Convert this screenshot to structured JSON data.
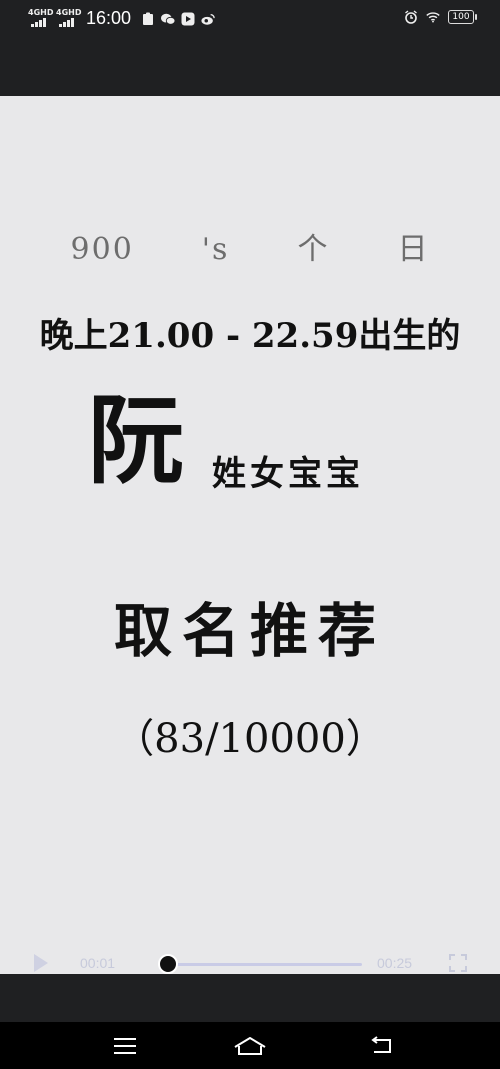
{
  "status_bar": {
    "signal1": "4GHD",
    "signal2": "4GHD",
    "time": "16:00",
    "battery": "100"
  },
  "video": {
    "line1": [
      "900",
      "'s",
      "个",
      "日"
    ],
    "line2": "晚上21.00 - 22.59出生的",
    "surname": "阮",
    "surname_suffix": "姓女宝宝",
    "heading": "取名推荐",
    "count": "（83/10000）"
  },
  "player": {
    "current_time": "00:01",
    "duration": "00:25",
    "progress": 0.04
  },
  "colors": {
    "status_bg": "#1f2022",
    "video_bg": "#e8e8ea",
    "text": "#111111",
    "track": "#c9cbe6"
  }
}
